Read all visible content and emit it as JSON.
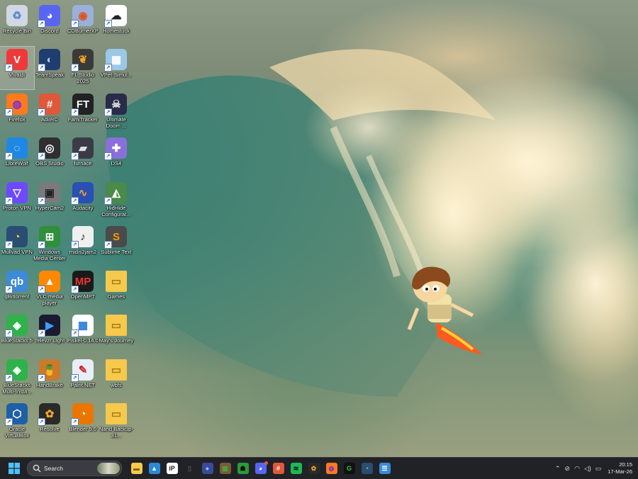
{
  "desktop": {
    "icons": [
      {
        "label": "Recycle Bin",
        "icon": "recycle-bin-icon",
        "bg": "#cfd8e3",
        "glyph": "♻",
        "fg": "#5a8ad0",
        "shortcut": false
      },
      {
        "label": "Discord",
        "icon": "discord-icon",
        "bg": "#5865f2",
        "glyph": "◕",
        "fg": "#fff",
        "shortcut": true
      },
      {
        "label": "CDBurnerXP",
        "icon": "cdburner-icon",
        "bg": "#9ab0d8",
        "glyph": "◉",
        "fg": "#e05020",
        "shortcut": true
      },
      {
        "label": "Homestuck",
        "icon": "homestuck-icon",
        "bg": "#ffffff",
        "glyph": "☁",
        "fg": "#222",
        "shortcut": true
      },
      {
        "label": "Vivaldi",
        "icon": "vivaldi-icon",
        "bg": "#ef3939",
        "glyph": "V",
        "fg": "#fff",
        "shortcut": true
      },
      {
        "label": "TeamSpeak",
        "icon": "teamspeak-icon",
        "bg": "#1f3d6e",
        "glyph": "◐",
        "fg": "#9fd0ff",
        "shortcut": true
      },
      {
        "label": "FL Studio 2025",
        "icon": "fl-studio-icon",
        "bg": "#3a3a3a",
        "glyph": "❦",
        "fg": "#f5a623",
        "shortcut": true
      },
      {
        "label": "VPet-Simul...",
        "icon": "vpet-icon",
        "bg": "#9cc8e8",
        "glyph": "▦",
        "fg": "#fff",
        "shortcut": true
      },
      {
        "label": "Firefox",
        "icon": "firefox-icon",
        "bg": "#ff7a1a",
        "glyph": "◍",
        "fg": "#7a2bd6",
        "shortcut": true
      },
      {
        "label": "AdiIRC",
        "icon": "adiirc-icon",
        "bg": "#e0573a",
        "glyph": "#",
        "fg": "#fff",
        "shortcut": true
      },
      {
        "label": "FamiTracker",
        "icon": "famitracker-icon",
        "bg": "#222",
        "glyph": "FT",
        "fg": "#fff",
        "shortcut": true
      },
      {
        "label": "Ultimate Doom ...",
        "icon": "doom-icon",
        "bg": "#2a2a4a",
        "glyph": "☠",
        "fg": "#ddd",
        "shortcut": true
      },
      {
        "label": "LibreWolf",
        "icon": "librewolf-icon",
        "bg": "#1e88e5",
        "glyph": "◌",
        "fg": "#fff",
        "shortcut": true
      },
      {
        "label": "OBS Studio",
        "icon": "obs-icon",
        "bg": "#302e31",
        "glyph": "◎",
        "fg": "#fff",
        "shortcut": true
      },
      {
        "label": "furnace",
        "icon": "furnace-icon",
        "bg": "#3b3b45",
        "glyph": "▰",
        "fg": "#ddd",
        "shortcut": true
      },
      {
        "label": "DS4",
        "icon": "ds4-icon",
        "bg": "#8b6fd9",
        "glyph": "✚",
        "fg": "#fff",
        "shortcut": true
      },
      {
        "label": "Proton VPN",
        "icon": "proton-vpn-icon",
        "bg": "#6d4aff",
        "glyph": "▽",
        "fg": "#fff",
        "shortcut": true
      },
      {
        "label": "HyperCam2",
        "icon": "hypercam-icon",
        "bg": "#7a7a7a",
        "glyph": "▣",
        "fg": "#222",
        "shortcut": true
      },
      {
        "label": "Audacity",
        "icon": "audacity-icon",
        "bg": "#2a4fb5",
        "glyph": "∿",
        "fg": "#f5a623",
        "shortcut": true
      },
      {
        "label": "HidHide Configurat...",
        "icon": "hidhide-icon",
        "bg": "#4a8a4a",
        "glyph": "◭",
        "fg": "#fff",
        "shortcut": true
      },
      {
        "label": "Mullvad VPN",
        "icon": "mullvad-icon",
        "bg": "#294d73",
        "glyph": "◔",
        "fg": "#ffd524",
        "shortcut": true
      },
      {
        "label": "Windows Media Center",
        "icon": "windows-media-center-icon",
        "bg": "#2f8f3a",
        "glyph": "⊞",
        "fg": "#fff",
        "shortcut": true
      },
      {
        "label": "midis2jam2",
        "icon": "midis2jam2-icon",
        "bg": "#f0f0f0",
        "glyph": "♪",
        "fg": "#222",
        "shortcut": true
      },
      {
        "label": "Sublime Text",
        "icon": "sublime-text-icon",
        "bg": "#4a4a4a",
        "glyph": "S",
        "fg": "#ff9800",
        "shortcut": true
      },
      {
        "label": "qBittorrent",
        "icon": "qbittorrent-icon",
        "bg": "#3d8ad8",
        "glyph": "qb",
        "fg": "#fff",
        "shortcut": true
      },
      {
        "label": "VLC media player",
        "icon": "vlc-icon",
        "bg": "#ff8800",
        "glyph": "▲",
        "fg": "#fff",
        "shortcut": true
      },
      {
        "label": "OpenMPT",
        "icon": "openmpt-icon",
        "bg": "#1a1a1a",
        "glyph": "MP",
        "fg": "#e33",
        "shortcut": true
      },
      {
        "label": "Games",
        "icon": "folder-icon",
        "bg": "#f6c84c",
        "glyph": "▭",
        "fg": "#a77a10",
        "shortcut": false
      },
      {
        "label": "BlueStacks 5",
        "icon": "bluestacks-icon",
        "bg": "#2fb24a",
        "glyph": "◈",
        "fg": "#fff",
        "shortcut": true
      },
      {
        "label": "Televzr Light",
        "icon": "televzr-icon",
        "bg": "#1a1a30",
        "glyph": "▶",
        "fg": "#38a0ff",
        "shortcut": true
      },
      {
        "label": "Piskel-0.14.0",
        "icon": "piskel-icon",
        "bg": "#ffffff",
        "glyph": "▦",
        "fg": "#2a7ad8",
        "shortcut": true
      },
      {
        "label": "May's Journey",
        "icon": "folder-icon",
        "bg": "#f6c84c",
        "glyph": "▭",
        "fg": "#a77a10",
        "shortcut": false
      },
      {
        "label": "BlueStacks Multi-Insta...",
        "icon": "bluestacks-multi-icon",
        "bg": "#2fb24a",
        "glyph": "◈",
        "fg": "#fff",
        "shortcut": true
      },
      {
        "label": "HandBrake",
        "icon": "handbrake-icon",
        "bg": "#c97a2a",
        "glyph": "🍍",
        "fg": "#fff",
        "shortcut": true
      },
      {
        "label": "Paint.NET",
        "icon": "paint-net-icon",
        "bg": "#e8eef8",
        "glyph": "✎",
        "fg": "#c22",
        "shortcut": true
      },
      {
        "label": "wbfs",
        "icon": "folder-icon",
        "bg": "#f6c84c",
        "glyph": "▭",
        "fg": "#a77a10",
        "shortcut": false
      },
      {
        "label": "Oracle VirtualBox",
        "icon": "virtualbox-icon",
        "bg": "#1f5fa6",
        "glyph": "⬡",
        "fg": "#fff",
        "shortcut": true
      },
      {
        "label": "Resolve",
        "icon": "resolve-icon",
        "bg": "#2a2a2a",
        "glyph": "✿",
        "fg": "#f5a623",
        "shortcut": true
      },
      {
        "label": "Blender 5.0",
        "icon": "blender-icon",
        "bg": "#ea7600",
        "glyph": "◔",
        "fg": "#fff",
        "shortcut": true
      },
      {
        "label": "Nand Backup-31...",
        "icon": "folder-icon",
        "bg": "#f6c84c",
        "glyph": "▭",
        "fg": "#a77a10",
        "shortcut": false
      }
    ]
  },
  "taskbar": {
    "search_label": "Search",
    "apps": [
      {
        "icon": "file-explorer-icon",
        "glyph": "▬",
        "bg": "#f6c84c",
        "fg": "#7a5a10"
      },
      {
        "icon": "photos-icon",
        "glyph": "▲",
        "bg": "#2a8ad8",
        "fg": "#fff"
      },
      {
        "icon": "ibis-paint-icon",
        "glyph": "iP",
        "bg": "#ffffff",
        "fg": "#222"
      },
      {
        "icon": "phone-icon",
        "glyph": "▯",
        "bg": "#202226",
        "fg": "#555"
      },
      {
        "icon": "marble-icon",
        "glyph": "●",
        "bg": "#3a4a9a",
        "fg": "#a0c0ff"
      },
      {
        "icon": "minecraft-dungeons-icon",
        "glyph": "▩",
        "bg": "#7a5a3a",
        "fg": "#4a3"
      },
      {
        "icon": "minecraft-icon",
        "glyph": "☗",
        "bg": "#2a9a3a",
        "fg": "#111"
      },
      {
        "icon": "discord-icon",
        "glyph": "◕",
        "bg": "#5865f2",
        "fg": "#fff"
      },
      {
        "icon": "adiirc-icon",
        "glyph": "#",
        "bg": "#e0573a",
        "fg": "#fff"
      },
      {
        "icon": "spotify-icon",
        "glyph": "≋",
        "bg": "#1db954",
        "fg": "#111"
      },
      {
        "icon": "resolve-icon",
        "glyph": "✿",
        "bg": "#2a2a2a",
        "fg": "#f5a623"
      },
      {
        "icon": "firefox-icon",
        "glyph": "◍",
        "bg": "#ff7a1a",
        "fg": "#7a2bd6"
      },
      {
        "icon": "g-hub-icon",
        "glyph": "G",
        "bg": "#111",
        "fg": "#2ad03a"
      },
      {
        "icon": "mullvad-icon",
        "glyph": "◔",
        "bg": "#294d73",
        "fg": "#ffd524"
      },
      {
        "icon": "notepad-icon",
        "glyph": "☰",
        "bg": "#3a8ad8",
        "fg": "#fff"
      }
    ],
    "clock": {
      "time": "20:15",
      "date": "17-Mar-26"
    }
  }
}
